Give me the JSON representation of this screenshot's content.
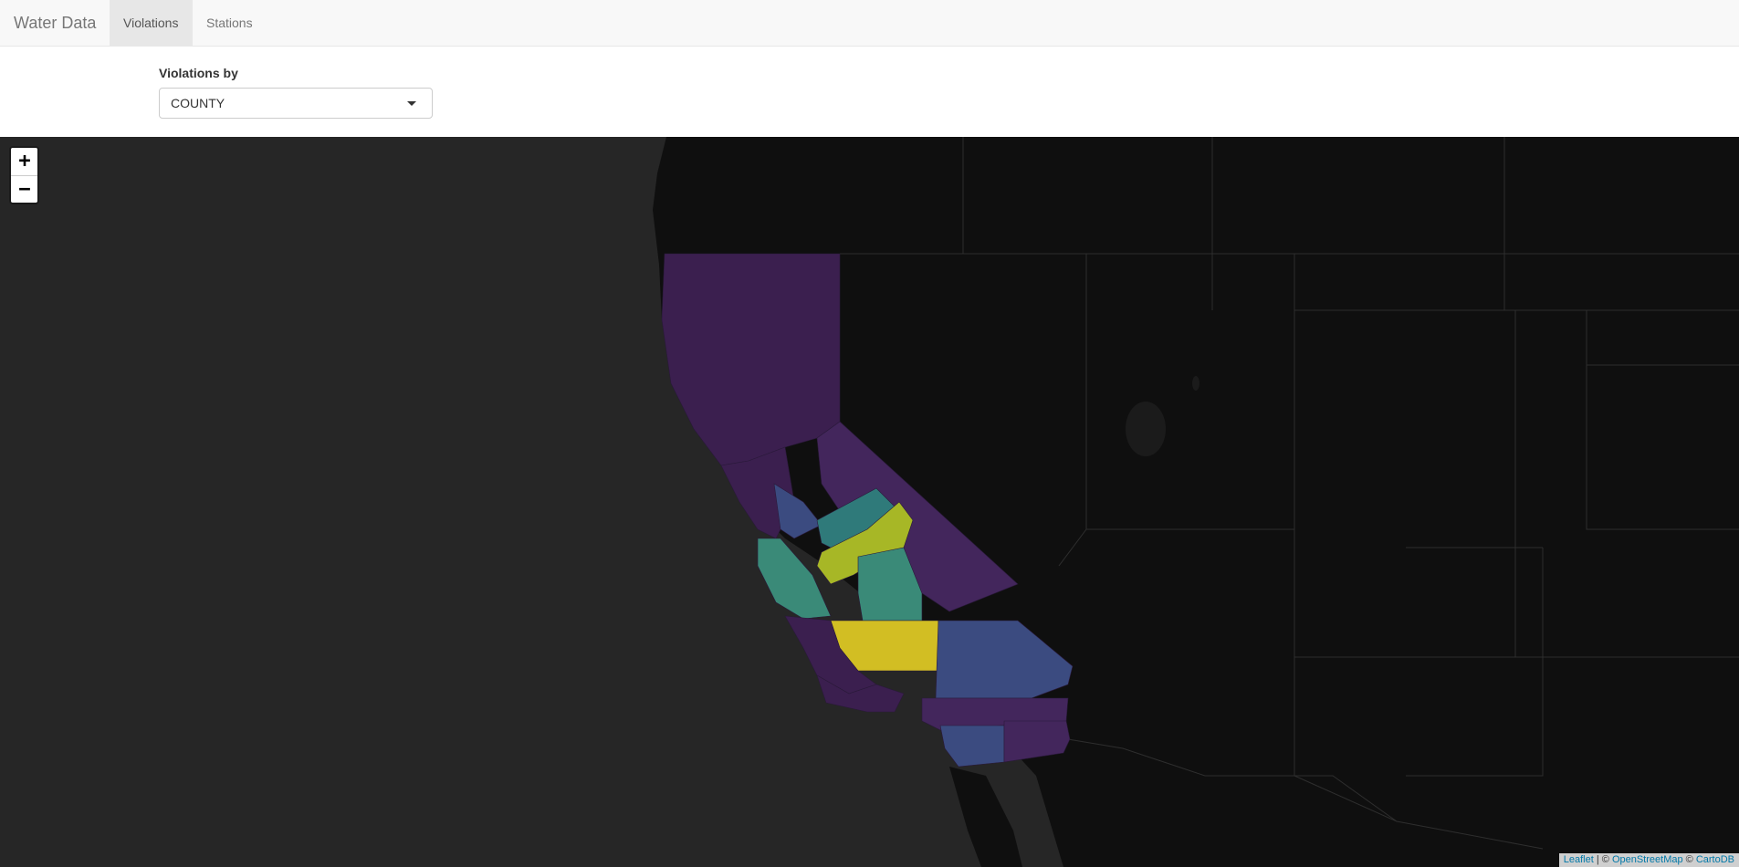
{
  "navbar": {
    "brand": "Water Data",
    "tabs": [
      {
        "label": "Violations",
        "active": true
      },
      {
        "label": "Stations",
        "active": false
      }
    ]
  },
  "controls": {
    "label": "Violations by",
    "select_value": "COUNTY"
  },
  "map": {
    "zoom_in": "+",
    "zoom_out": "−",
    "attribution": {
      "leaflet": "Leaflet",
      "sep1": " | © ",
      "osm": "OpenStreetMap",
      "sep2": " © ",
      "carto": "CartoDB"
    },
    "palette": {
      "low": "#3b1f4f",
      "low2": "#43265c",
      "mid_low": "#3b4b80",
      "mid": "#2f7a7a",
      "mid_high": "#3a8a78",
      "high": "#a7b726",
      "highest": "#d2be23",
      "land": "#0f0f0f",
      "ocean": "#262626"
    }
  }
}
